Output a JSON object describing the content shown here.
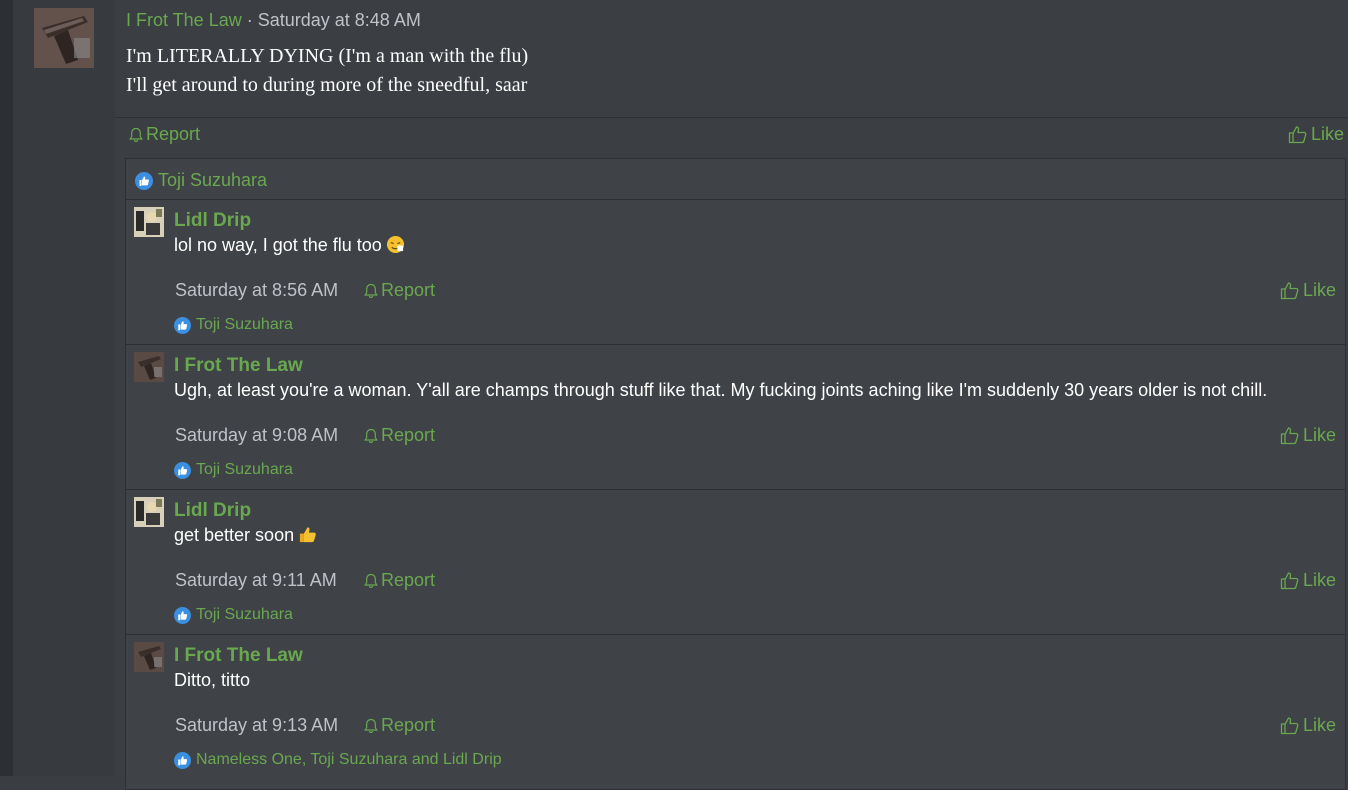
{
  "post": {
    "author": "I Frot The Law",
    "separator": " · ",
    "date": "Saturday at 8:48 AM",
    "body_lines": [
      "I'm LITERALLY DYING (I'm a man with the flu)",
      "I'll get around to during more of the sneedful, saar"
    ],
    "report_label": "Report",
    "like_label": "Like",
    "liked_by": "Toji Suzuhara"
  },
  "replies": [
    {
      "author": "Lidl Drip",
      "text": "lol no way, I got the flu too",
      "emoji": "sneezing-face-emoji",
      "date": "Saturday at 8:56 AM",
      "report_label": "Report",
      "like_label": "Like",
      "liked_by": "Toji Suzuhara"
    },
    {
      "author": "I Frot The Law",
      "text": "Ugh, at least you're a woman. Y'all are champs through stuff like that. My fucking joints aching like I'm suddenly 30 years older is not chill.",
      "date": "Saturday at 9:08 AM",
      "report_label": "Report",
      "like_label": "Like",
      "liked_by": "Toji Suzuhara"
    },
    {
      "author": "Lidl Drip",
      "text": "get better soon",
      "emoji": "thumbs-up-emoji",
      "date": "Saturday at 9:11 AM",
      "report_label": "Report",
      "like_label": "Like",
      "liked_by": "Toji Suzuhara"
    },
    {
      "author": "I Frot The Law",
      "text": "Ditto, titto",
      "date": "Saturday at 9:13 AM",
      "report_label": "Report",
      "like_label": "Like",
      "liked_by": "Nameless One, Toji Suzuhara and Lidl Drip"
    }
  ],
  "colors": {
    "accent": "#6aa84f",
    "background": "#3b3e43",
    "reaction": "#3b8fe0"
  },
  "icons": {
    "report": "bell-icon",
    "like": "thumbs-up-icon",
    "reaction": "like-reaction-icon"
  }
}
